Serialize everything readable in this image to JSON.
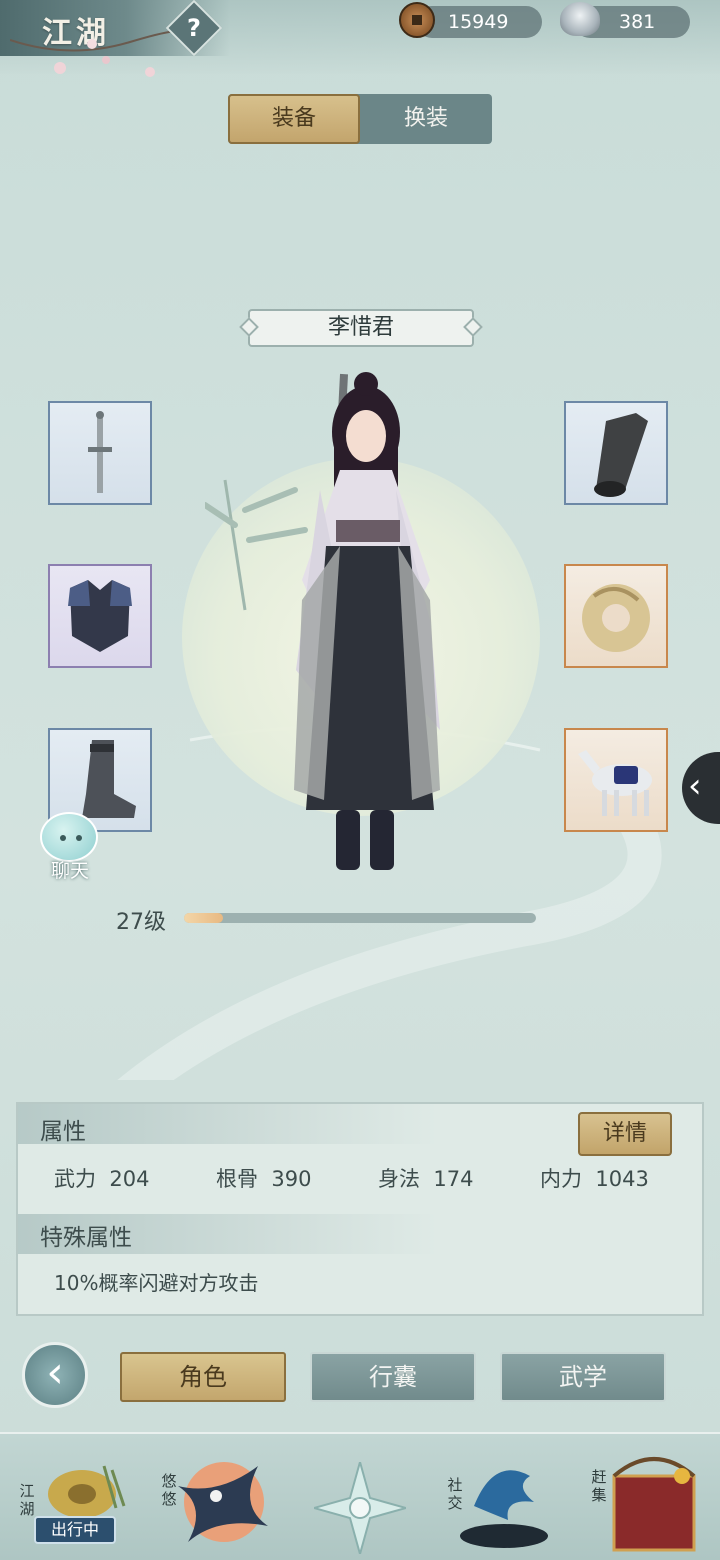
{
  "header": {
    "title": "江湖",
    "help_icon": "question-icon",
    "copper_amount": "15949",
    "silver_amount": "381"
  },
  "tabs": [
    {
      "label": "装备",
      "active": true
    },
    {
      "label": "换装",
      "active": false
    }
  ],
  "character": {
    "name": "李惜君",
    "level_label": "27级",
    "level_progress": 0.11
  },
  "equipment_slots": {
    "left": [
      {
        "item": "sword-icon",
        "rarity": "blue"
      },
      {
        "item": "armor-icon",
        "rarity": "purple"
      },
      {
        "item": "boots-icon",
        "rarity": "blue"
      }
    ],
    "right": [
      {
        "item": "bracer-icon",
        "rarity": "blue"
      },
      {
        "item": "jade-pendant-icon",
        "rarity": "orange"
      },
      {
        "item": "horse-icon",
        "rarity": "orange"
      }
    ]
  },
  "chat": {
    "label": "聊天"
  },
  "attributes": {
    "title": "属性",
    "detail_button": "详情",
    "stats": [
      {
        "label": "武力",
        "value": "204"
      },
      {
        "label": "根骨",
        "value": "390"
      },
      {
        "label": "身法",
        "value": "174"
      },
      {
        "label": "内力",
        "value": "1043"
      }
    ],
    "special_title": "特殊属性",
    "special_text": "10%概率闪避对方攻击"
  },
  "bottom_tabs": [
    {
      "label": "角色",
      "active": true
    },
    {
      "label": "行囊",
      "active": false
    },
    {
      "label": "武学",
      "active": false
    }
  ],
  "dock": {
    "items": [
      {
        "label": "江湖",
        "badge": "出行中"
      },
      {
        "label": "悠悠"
      },
      {
        "label": ""
      },
      {
        "label": "社交"
      },
      {
        "label": "赶集"
      }
    ]
  },
  "colors": {
    "accent_gold": "#c3a56d",
    "teal_bg": "#cfe0dc",
    "slot_blue": "#6c88a6",
    "slot_purple": "#8c7fb0",
    "slot_orange": "#c8874c"
  }
}
